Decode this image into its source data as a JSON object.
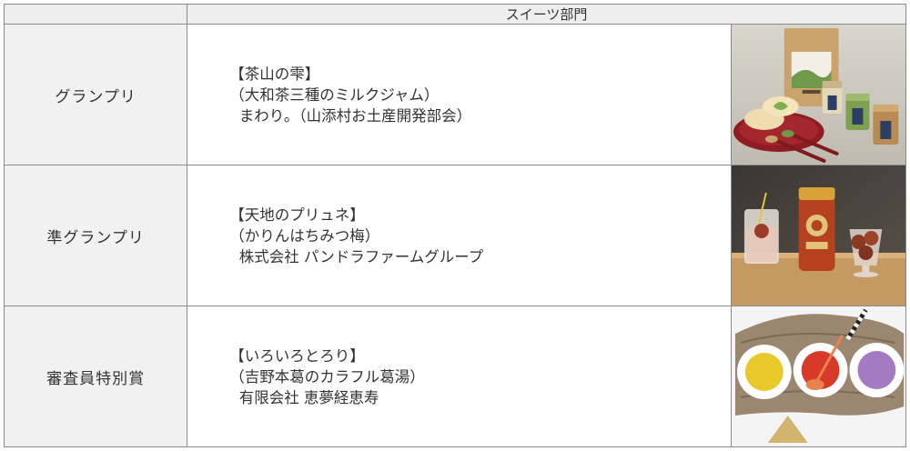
{
  "category": "スイーツ部門",
  "awards": [
    {
      "award": "グランプリ",
      "product": "【茶山の雫】",
      "subtitle": "（大和茶三種のミルクジャム）",
      "maker": "まわり。（山添村お土産開発部会）",
      "photo_icon": "tea-jam-photo"
    },
    {
      "award": "準グランプリ",
      "product": "【天地のプリュネ】",
      "subtitle": "（かりんはちみつ梅）",
      "maker": "株式会社 パンドラファームグループ",
      "photo_icon": "plum-honey-photo"
    },
    {
      "award": "審査員特別賞",
      "product": "【いろいろとろり】",
      "subtitle": "（吉野本葛のカラフル葛湯）",
      "maker": "有限会社 恵夢経恵寿",
      "photo_icon": "kuzuyu-photo"
    }
  ],
  "colors": {
    "border": "#8a8a8a",
    "label_bg": "#f1f1f1",
    "header_bg": "#eeeeee"
  }
}
